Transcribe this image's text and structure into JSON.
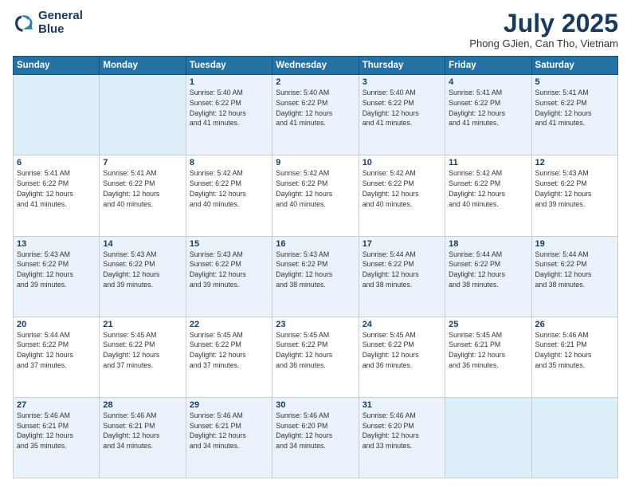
{
  "logo": {
    "line1": "General",
    "line2": "Blue"
  },
  "title": "July 2025",
  "location": "Phong GJien, Can Tho, Vietnam",
  "days_of_week": [
    "Sunday",
    "Monday",
    "Tuesday",
    "Wednesday",
    "Thursday",
    "Friday",
    "Saturday"
  ],
  "weeks": [
    [
      {
        "day": "",
        "info": ""
      },
      {
        "day": "",
        "info": ""
      },
      {
        "day": "1",
        "info": "Sunrise: 5:40 AM\nSunset: 6:22 PM\nDaylight: 12 hours\nand 41 minutes."
      },
      {
        "day": "2",
        "info": "Sunrise: 5:40 AM\nSunset: 6:22 PM\nDaylight: 12 hours\nand 41 minutes."
      },
      {
        "day": "3",
        "info": "Sunrise: 5:40 AM\nSunset: 6:22 PM\nDaylight: 12 hours\nand 41 minutes."
      },
      {
        "day": "4",
        "info": "Sunrise: 5:41 AM\nSunset: 6:22 PM\nDaylight: 12 hours\nand 41 minutes."
      },
      {
        "day": "5",
        "info": "Sunrise: 5:41 AM\nSunset: 6:22 PM\nDaylight: 12 hours\nand 41 minutes."
      }
    ],
    [
      {
        "day": "6",
        "info": "Sunrise: 5:41 AM\nSunset: 6:22 PM\nDaylight: 12 hours\nand 41 minutes."
      },
      {
        "day": "7",
        "info": "Sunrise: 5:41 AM\nSunset: 6:22 PM\nDaylight: 12 hours\nand 40 minutes."
      },
      {
        "day": "8",
        "info": "Sunrise: 5:42 AM\nSunset: 6:22 PM\nDaylight: 12 hours\nand 40 minutes."
      },
      {
        "day": "9",
        "info": "Sunrise: 5:42 AM\nSunset: 6:22 PM\nDaylight: 12 hours\nand 40 minutes."
      },
      {
        "day": "10",
        "info": "Sunrise: 5:42 AM\nSunset: 6:22 PM\nDaylight: 12 hours\nand 40 minutes."
      },
      {
        "day": "11",
        "info": "Sunrise: 5:42 AM\nSunset: 6:22 PM\nDaylight: 12 hours\nand 40 minutes."
      },
      {
        "day": "12",
        "info": "Sunrise: 5:43 AM\nSunset: 6:22 PM\nDaylight: 12 hours\nand 39 minutes."
      }
    ],
    [
      {
        "day": "13",
        "info": "Sunrise: 5:43 AM\nSunset: 6:22 PM\nDaylight: 12 hours\nand 39 minutes."
      },
      {
        "day": "14",
        "info": "Sunrise: 5:43 AM\nSunset: 6:22 PM\nDaylight: 12 hours\nand 39 minutes."
      },
      {
        "day": "15",
        "info": "Sunrise: 5:43 AM\nSunset: 6:22 PM\nDaylight: 12 hours\nand 39 minutes."
      },
      {
        "day": "16",
        "info": "Sunrise: 5:43 AM\nSunset: 6:22 PM\nDaylight: 12 hours\nand 38 minutes."
      },
      {
        "day": "17",
        "info": "Sunrise: 5:44 AM\nSunset: 6:22 PM\nDaylight: 12 hours\nand 38 minutes."
      },
      {
        "day": "18",
        "info": "Sunrise: 5:44 AM\nSunset: 6:22 PM\nDaylight: 12 hours\nand 38 minutes."
      },
      {
        "day": "19",
        "info": "Sunrise: 5:44 AM\nSunset: 6:22 PM\nDaylight: 12 hours\nand 38 minutes."
      }
    ],
    [
      {
        "day": "20",
        "info": "Sunrise: 5:44 AM\nSunset: 6:22 PM\nDaylight: 12 hours\nand 37 minutes."
      },
      {
        "day": "21",
        "info": "Sunrise: 5:45 AM\nSunset: 6:22 PM\nDaylight: 12 hours\nand 37 minutes."
      },
      {
        "day": "22",
        "info": "Sunrise: 5:45 AM\nSunset: 6:22 PM\nDaylight: 12 hours\nand 37 minutes."
      },
      {
        "day": "23",
        "info": "Sunrise: 5:45 AM\nSunset: 6:22 PM\nDaylight: 12 hours\nand 36 minutes."
      },
      {
        "day": "24",
        "info": "Sunrise: 5:45 AM\nSunset: 6:22 PM\nDaylight: 12 hours\nand 36 minutes."
      },
      {
        "day": "25",
        "info": "Sunrise: 5:45 AM\nSunset: 6:21 PM\nDaylight: 12 hours\nand 36 minutes."
      },
      {
        "day": "26",
        "info": "Sunrise: 5:46 AM\nSunset: 6:21 PM\nDaylight: 12 hours\nand 35 minutes."
      }
    ],
    [
      {
        "day": "27",
        "info": "Sunrise: 5:46 AM\nSunset: 6:21 PM\nDaylight: 12 hours\nand 35 minutes."
      },
      {
        "day": "28",
        "info": "Sunrise: 5:46 AM\nSunset: 6:21 PM\nDaylight: 12 hours\nand 34 minutes."
      },
      {
        "day": "29",
        "info": "Sunrise: 5:46 AM\nSunset: 6:21 PM\nDaylight: 12 hours\nand 34 minutes."
      },
      {
        "day": "30",
        "info": "Sunrise: 5:46 AM\nSunset: 6:20 PM\nDaylight: 12 hours\nand 34 minutes."
      },
      {
        "day": "31",
        "info": "Sunrise: 5:46 AM\nSunset: 6:20 PM\nDaylight: 12 hours\nand 33 minutes."
      },
      {
        "day": "",
        "info": ""
      },
      {
        "day": "",
        "info": ""
      }
    ]
  ]
}
